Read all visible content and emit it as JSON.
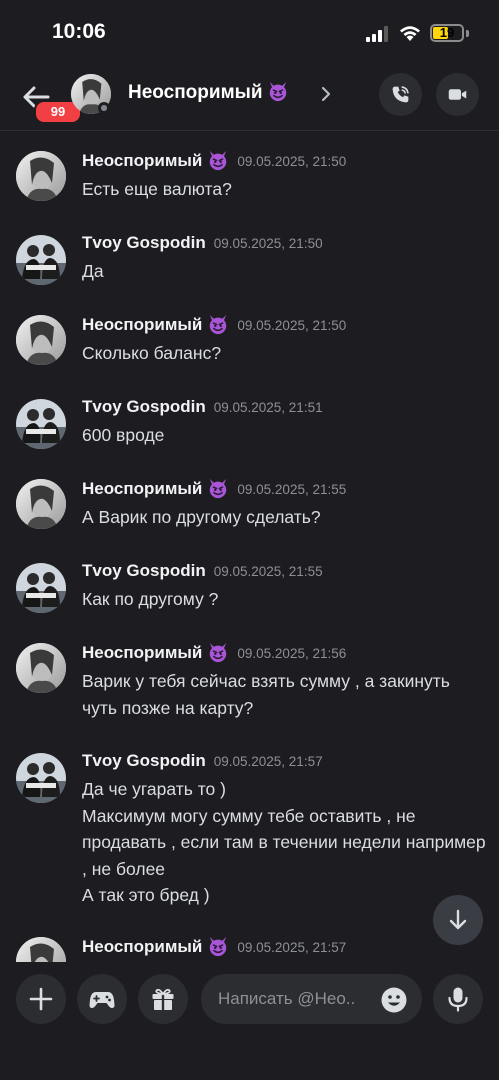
{
  "status_bar": {
    "time": "10:06",
    "battery": "19",
    "icons": [
      "signal-icon",
      "wifi-icon",
      "battery-icon"
    ]
  },
  "header": {
    "back_icon": "arrow-left-icon",
    "unread_badge": "99",
    "contact_name": "Неоспоримый",
    "contact_emoji": "smiling-imp",
    "call_icon": "phone-call-icon",
    "video_icon": "video-camera-icon"
  },
  "messages": [
    {
      "author": "Неоспоримый",
      "emoji": true,
      "timestamp": "09.05.2025, 21:50",
      "text": "Есть еще валюта?"
    },
    {
      "author": "Tvoy Gospodin",
      "emoji": false,
      "timestamp": "09.05.2025, 21:50",
      "text": "Да"
    },
    {
      "author": "Неоспоримый",
      "emoji": true,
      "timestamp": "09.05.2025, 21:50",
      "text": "Сколько баланс?"
    },
    {
      "author": "Tvoy Gospodin",
      "emoji": false,
      "timestamp": "09.05.2025, 21:51",
      "text": "600 вроде"
    },
    {
      "author": "Неоспоримый",
      "emoji": true,
      "timestamp": "09.05.2025, 21:55",
      "text": "А Варик по другому сделать?"
    },
    {
      "author": "Tvoy Gospodin",
      "emoji": false,
      "timestamp": "09.05.2025, 21:55",
      "text": "Как по другому ?"
    },
    {
      "author": "Неоспоримый",
      "emoji": true,
      "timestamp": "09.05.2025, 21:56",
      "text": "Варик у тебя сейчас взять сумму , а закинуть чуть позже на карту?"
    },
    {
      "author": "Tvoy Gospodin",
      "emoji": false,
      "timestamp": "09.05.2025, 21:57",
      "text": "Да че угарать то )\nМаксимум могу сумму тебе оставить , не продавать , если там в течении недели например , не более\nА так это бред )"
    },
    {
      "author": "Неоспоримый",
      "emoji": true,
      "timestamp": "09.05.2025, 21:57",
      "text": ""
    }
  ],
  "composer": {
    "placeholder": "Написать @Нео..",
    "buttons": [
      "plus-icon",
      "gamepad-icon",
      "gift-icon",
      "emoji-icon",
      "microphone-icon"
    ]
  },
  "colors": {
    "background": "#1c1c21",
    "button_bg": "#2b2d31",
    "badge": "#f23f43",
    "emoji_purple": "#a855d6"
  }
}
